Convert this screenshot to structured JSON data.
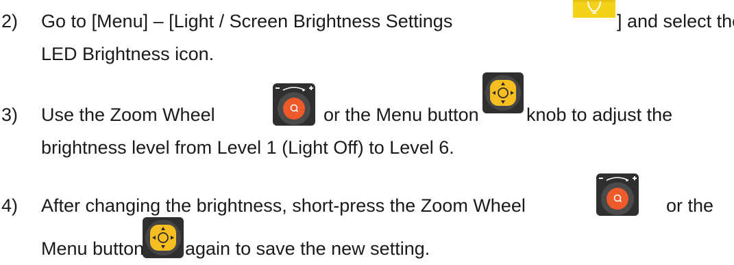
{
  "steps": [
    {
      "number": "2)",
      "line1_before": "Go to [Menu] – [Light / Screen Brightness Settings",
      "line1_after": "] and select the",
      "line2": "LED Brightness icon."
    },
    {
      "number": "3)",
      "line1_a": "Use the Zoom Wheel",
      "line1_b": "or the Menu button",
      "line1_c": "knob to adjust the",
      "line2": "brightness level from Level 1 (Light Off) to Level 6."
    },
    {
      "number": "4)",
      "line1_a": "After changing the brightness, short-press the Zoom Wheel",
      "line1_b": "or the",
      "line2_a": "Menu button",
      "line2_b": "again to save the new setting."
    }
  ],
  "icons": {
    "light_bulb": "light-bulb-icon",
    "zoom_wheel": "zoom-wheel-icon",
    "menu_button": "menu-button-icon",
    "zoom_wheel_minus": "−",
    "zoom_wheel_plus": "+",
    "colors": {
      "bulb_bg": "#f5d21a",
      "wheel_orange": "#ee5a2a",
      "menu_yellow": "#f7be22",
      "dark_ring": "#2a2a2a"
    }
  }
}
